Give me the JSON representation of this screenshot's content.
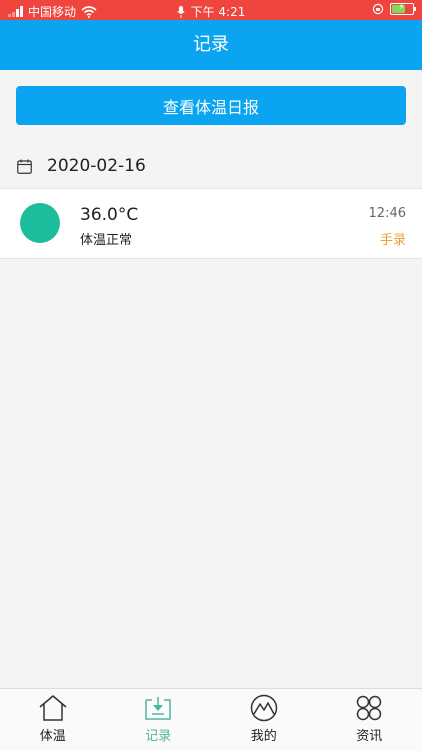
{
  "status_bar": {
    "carrier": "中国移动",
    "time": "下午 4:21"
  },
  "nav": {
    "title": "记录"
  },
  "report_button": {
    "label": "查看体温日报"
  },
  "date_header": {
    "date": "2020-02-16",
    "icon": "calendar-icon"
  },
  "records": [
    {
      "temperature": "36.0°C",
      "status": "体温正常",
      "time": "12:46",
      "source": "手录",
      "dot_color": "#1dbd9c"
    }
  ],
  "tabs": [
    {
      "label": "体温",
      "icon": "home-icon",
      "active": false
    },
    {
      "label": "记录",
      "icon": "download-tray-icon",
      "active": true
    },
    {
      "label": "我的",
      "icon": "mountain-badge-icon",
      "active": false
    },
    {
      "label": "资讯",
      "icon": "four-circles-icon",
      "active": false
    }
  ],
  "colors": {
    "primary": "#0aa4f0",
    "status_bar": "#f0443f",
    "accent_green": "#4fb6a1",
    "source_orange": "#f0a030"
  }
}
